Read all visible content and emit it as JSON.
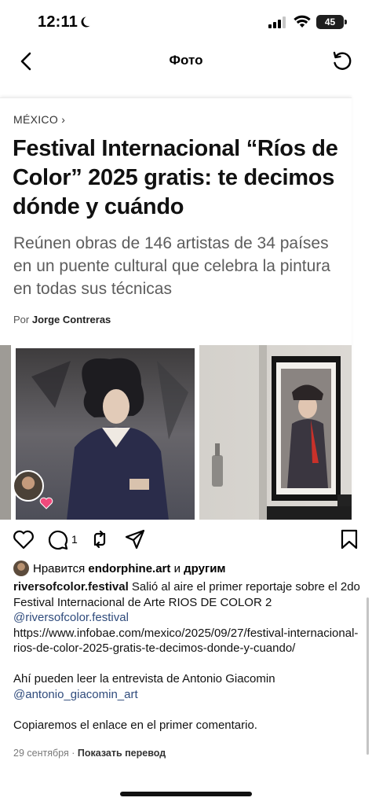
{
  "status_bar": {
    "time": "12:11",
    "battery": "45"
  },
  "nav": {
    "title": "Фото"
  },
  "article": {
    "section": "MÉXICO ›",
    "headline": "Festival Internacional “Ríos de Color” 2025 gratis: te decimos dónde y cuándo",
    "subhead": "Reúnen obras de 146 artistas de 34 países en un puente cultural que celebra la pintura en todas sus técnicas",
    "byline_prefix": "Por",
    "author": "Jorge Contreras"
  },
  "actions": {
    "comment_count": "1"
  },
  "likes": {
    "prefix": "Нравится",
    "user": "endorphine.art",
    "middle": "и",
    "others": "другим"
  },
  "caption": {
    "username": "riversofcolor.festival",
    "text1": "Salió al aire el primer reportaje sobre el 2do Festival Internacional de Arte RIOS DE COLOR 2",
    "mention1": "@riversofcolor.festival",
    "url": "https://www.infobae.com/mexico/2025/09/27/festival-internacional-rios-de-color-2025-gratis-te-decimos-donde-y-cuando/",
    "text2": "Ahí pueden leer la entrevista de Antonio Giacomin",
    "mention2": "@antonio_giacomin_art",
    "text3": "Copiaremos el enlace en el primer comentario."
  },
  "meta": {
    "date": "29 сентября",
    "separator": "·",
    "translate": "Показать перевод"
  },
  "colors": {
    "mention": "#2f4b7c",
    "subhead": "#5d5d5d",
    "meta": "#7a7a7a"
  }
}
